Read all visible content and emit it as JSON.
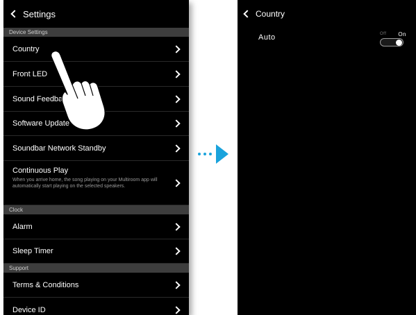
{
  "left": {
    "header_title": "Settings",
    "sections": [
      {
        "header": "Device Settings",
        "rows": [
          {
            "label": "Country"
          },
          {
            "label": "Front LED"
          },
          {
            "label": "Sound Feedback"
          },
          {
            "label": "Software Update"
          },
          {
            "label": "Soundbar Network Standby"
          },
          {
            "label": "Continuous Play",
            "description": "When you arrive home, the song playing on your Multiroom app will automatically start playing on the selected speakers."
          }
        ]
      },
      {
        "header": "Clock",
        "rows": [
          {
            "label": "Alarm"
          },
          {
            "label": "Sleep Timer"
          }
        ]
      },
      {
        "header": "Support",
        "rows": [
          {
            "label": "Terms & Conditions"
          },
          {
            "label": "Device ID"
          }
        ]
      }
    ]
  },
  "arrow_color": "#1aa3dc",
  "right": {
    "header_title": "Country",
    "auto_label": "Auto",
    "toggle_off_label": "Off",
    "toggle_on_label": "On",
    "toggle_state": "on"
  }
}
